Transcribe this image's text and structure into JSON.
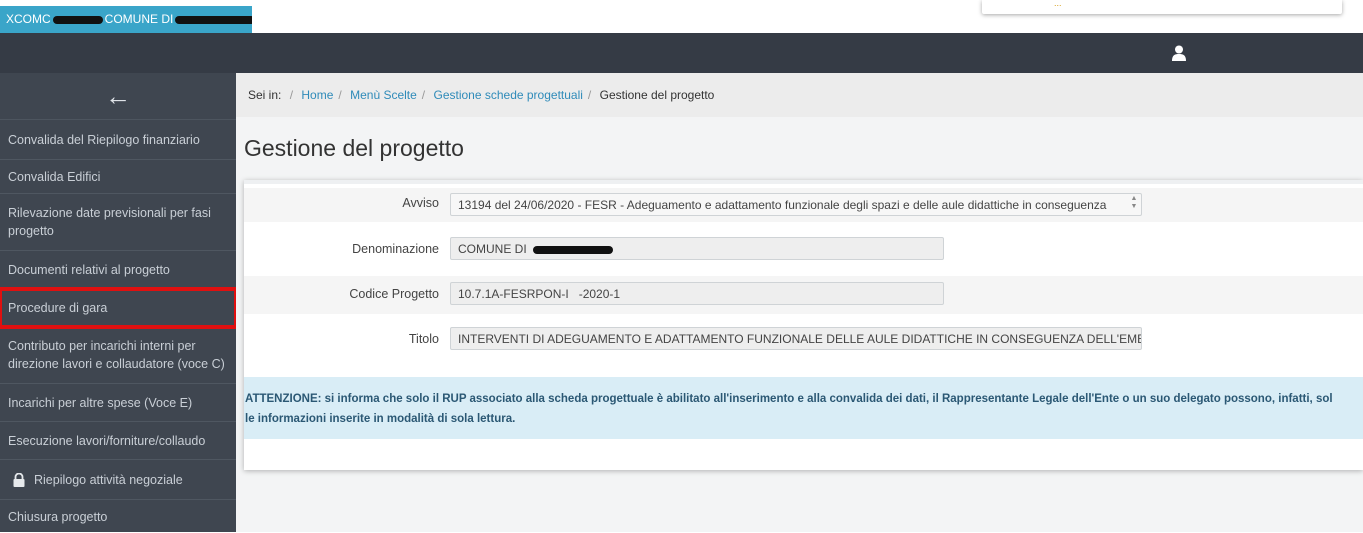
{
  "top_bar": {
    "school_code": "XCOMC",
    "school_name": "COMUNE DI",
    "notice_text": "..."
  },
  "colors": {
    "tab_accent": "#3aa5c9",
    "header_bg": "#353b45",
    "sidebar_bg": "#3f4650",
    "highlight_outline": "#e01010",
    "link": "#2f8bb9",
    "alert_bg": "#d9edf6"
  },
  "sidebar": {
    "back_icon": "arrow-left-icon",
    "items": [
      {
        "label": "Convalida del Riepilogo finanziario"
      },
      {
        "label": "Convalida Edifici"
      },
      {
        "label": "Rilevazione date previsionali per fasi progetto"
      },
      {
        "label": "Documenti relativi al progetto"
      },
      {
        "label": "Procedure di gara",
        "highlighted": true
      },
      {
        "label": "Contributo per incarichi interni per direzione lavori e collaudatore (voce C)"
      },
      {
        "label": "Incarichi per altre spese (Voce E)"
      },
      {
        "label": "Esecuzione lavori/forniture/collaudo"
      },
      {
        "label": "Riepilogo attività negoziale",
        "icon": "lock-icon"
      },
      {
        "label": "Chiusura progetto"
      }
    ]
  },
  "breadcrumb": {
    "prefix": "Sei in:",
    "links": [
      "Home",
      "Menù Scelte",
      "Gestione schede progettuali"
    ],
    "current": "Gestione del progetto"
  },
  "page": {
    "title": "Gestione del progetto"
  },
  "form": {
    "avviso_label": "Avviso",
    "avviso_value": "13194 del 24/06/2020 - FESR - Adeguamento e adattamento funzionale degli spazi e delle aule didattiche in conseguenza",
    "denominazione_label": "Denominazione",
    "denominazione_value": "COMUNE DI",
    "codice_label": "Codice Progetto",
    "codice_value": "10.7.1A-FESRPON-I   -2020-1",
    "titolo_label": "Titolo",
    "titolo_value": "INTERVENTI DI ADEGUAMENTO E ADATTAMENTO FUNZIONALE DELLE AULE DIDATTICHE IN CONSEGUENZA DELL'EMERGENZA"
  },
  "alert": {
    "line1": "ATTENZIONE: si informa che solo il RUP associato alla scheda progettuale è abilitato all'inserimento e alla convalida dei dati, il Rappresentante Legale dell'Ente o un suo delegato possono, infatti, sol",
    "line2": "le informazioni inserite in modalità di sola lettura."
  }
}
